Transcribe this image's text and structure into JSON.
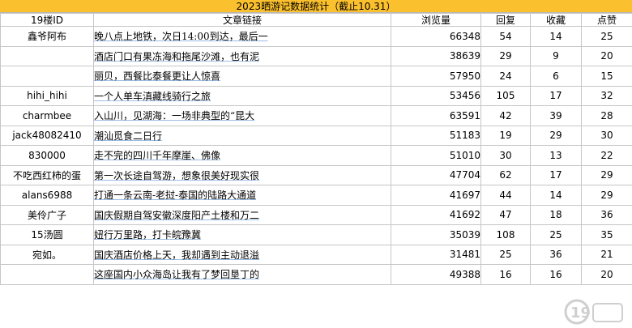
{
  "title": "2023晒游记数据统计（截止10.31）",
  "headers": {
    "user": "19楼ID",
    "title": "文章链接",
    "views": "浏览量",
    "replies": "回复",
    "favorites": "收藏",
    "likes": "点赞"
  },
  "rows": [
    {
      "user": "鑫爷阿布",
      "title": "晚八点上地铁，次日14:00到达，最后一",
      "views": "66348",
      "replies": "54",
      "favorites": "14",
      "likes": "25"
    },
    {
      "user": "",
      "title": "酒店门口有果冻海和拖尾沙滩，也有泥",
      "views": "38639",
      "replies": "29",
      "favorites": "9",
      "likes": "20"
    },
    {
      "user": "",
      "title": "丽贝，西餐比泰餐更让人惊喜",
      "views": "57950",
      "replies": "24",
      "favorites": "6",
      "likes": "15"
    },
    {
      "user": "hihi_hihi",
      "title": "一个人单车滇藏线骑行之旅",
      "views": "53456",
      "replies": "105",
      "favorites": "17",
      "likes": "32"
    },
    {
      "user": "charmbee",
      "title": "入山川，见湖海：一场非典型的“昆大",
      "views": "63591",
      "replies": "42",
      "favorites": "39",
      "likes": "28"
    },
    {
      "user": "jack48082410",
      "title": "潮汕觅食二日行",
      "views": "51183",
      "replies": "19",
      "favorites": "29",
      "likes": "30"
    },
    {
      "user": "830000",
      "title": "走不完的四川千年摩崖、佛像",
      "views": "51010",
      "replies": "30",
      "favorites": "13",
      "likes": "22"
    },
    {
      "user": "不吃西红柿的蛋",
      "title": "第一次长途自驾游，想象很美好现实很",
      "views": "47704",
      "replies": "62",
      "favorites": "17",
      "likes": "29"
    },
    {
      "user": "alans6988",
      "title": "打通一条云南-老挝-泰国的陆路大通道",
      "views": "41697",
      "replies": "44",
      "favorites": "14",
      "likes": "29"
    },
    {
      "user": "美伶广子",
      "title": "国庆假期自驾安徽深度阳产土楼和万二",
      "views": "41692",
      "replies": "47",
      "favorites": "18",
      "likes": "36"
    },
    {
      "user": "15汤圆",
      "title": "妞行万里路，打卡皖豫冀",
      "views": "35039",
      "replies": "108",
      "favorites": "25",
      "likes": "35"
    },
    {
      "user": "宛如。",
      "title": "国庆酒店价格上天，我却遇到主动退溢",
      "views": "31481",
      "replies": "25",
      "favorites": "36",
      "likes": "21"
    },
    {
      "user": "",
      "title": "这座国内小众海岛让我有了梦回垦丁的",
      "views": "49388",
      "replies": "16",
      "favorites": "16",
      "likes": "20"
    }
  ],
  "colors": {
    "title_bar": "#fbc02d",
    "link": "#6a9fd6",
    "user": "#3d6fb6"
  },
  "watermark": {
    "icon": "19lou-logo-icon"
  }
}
